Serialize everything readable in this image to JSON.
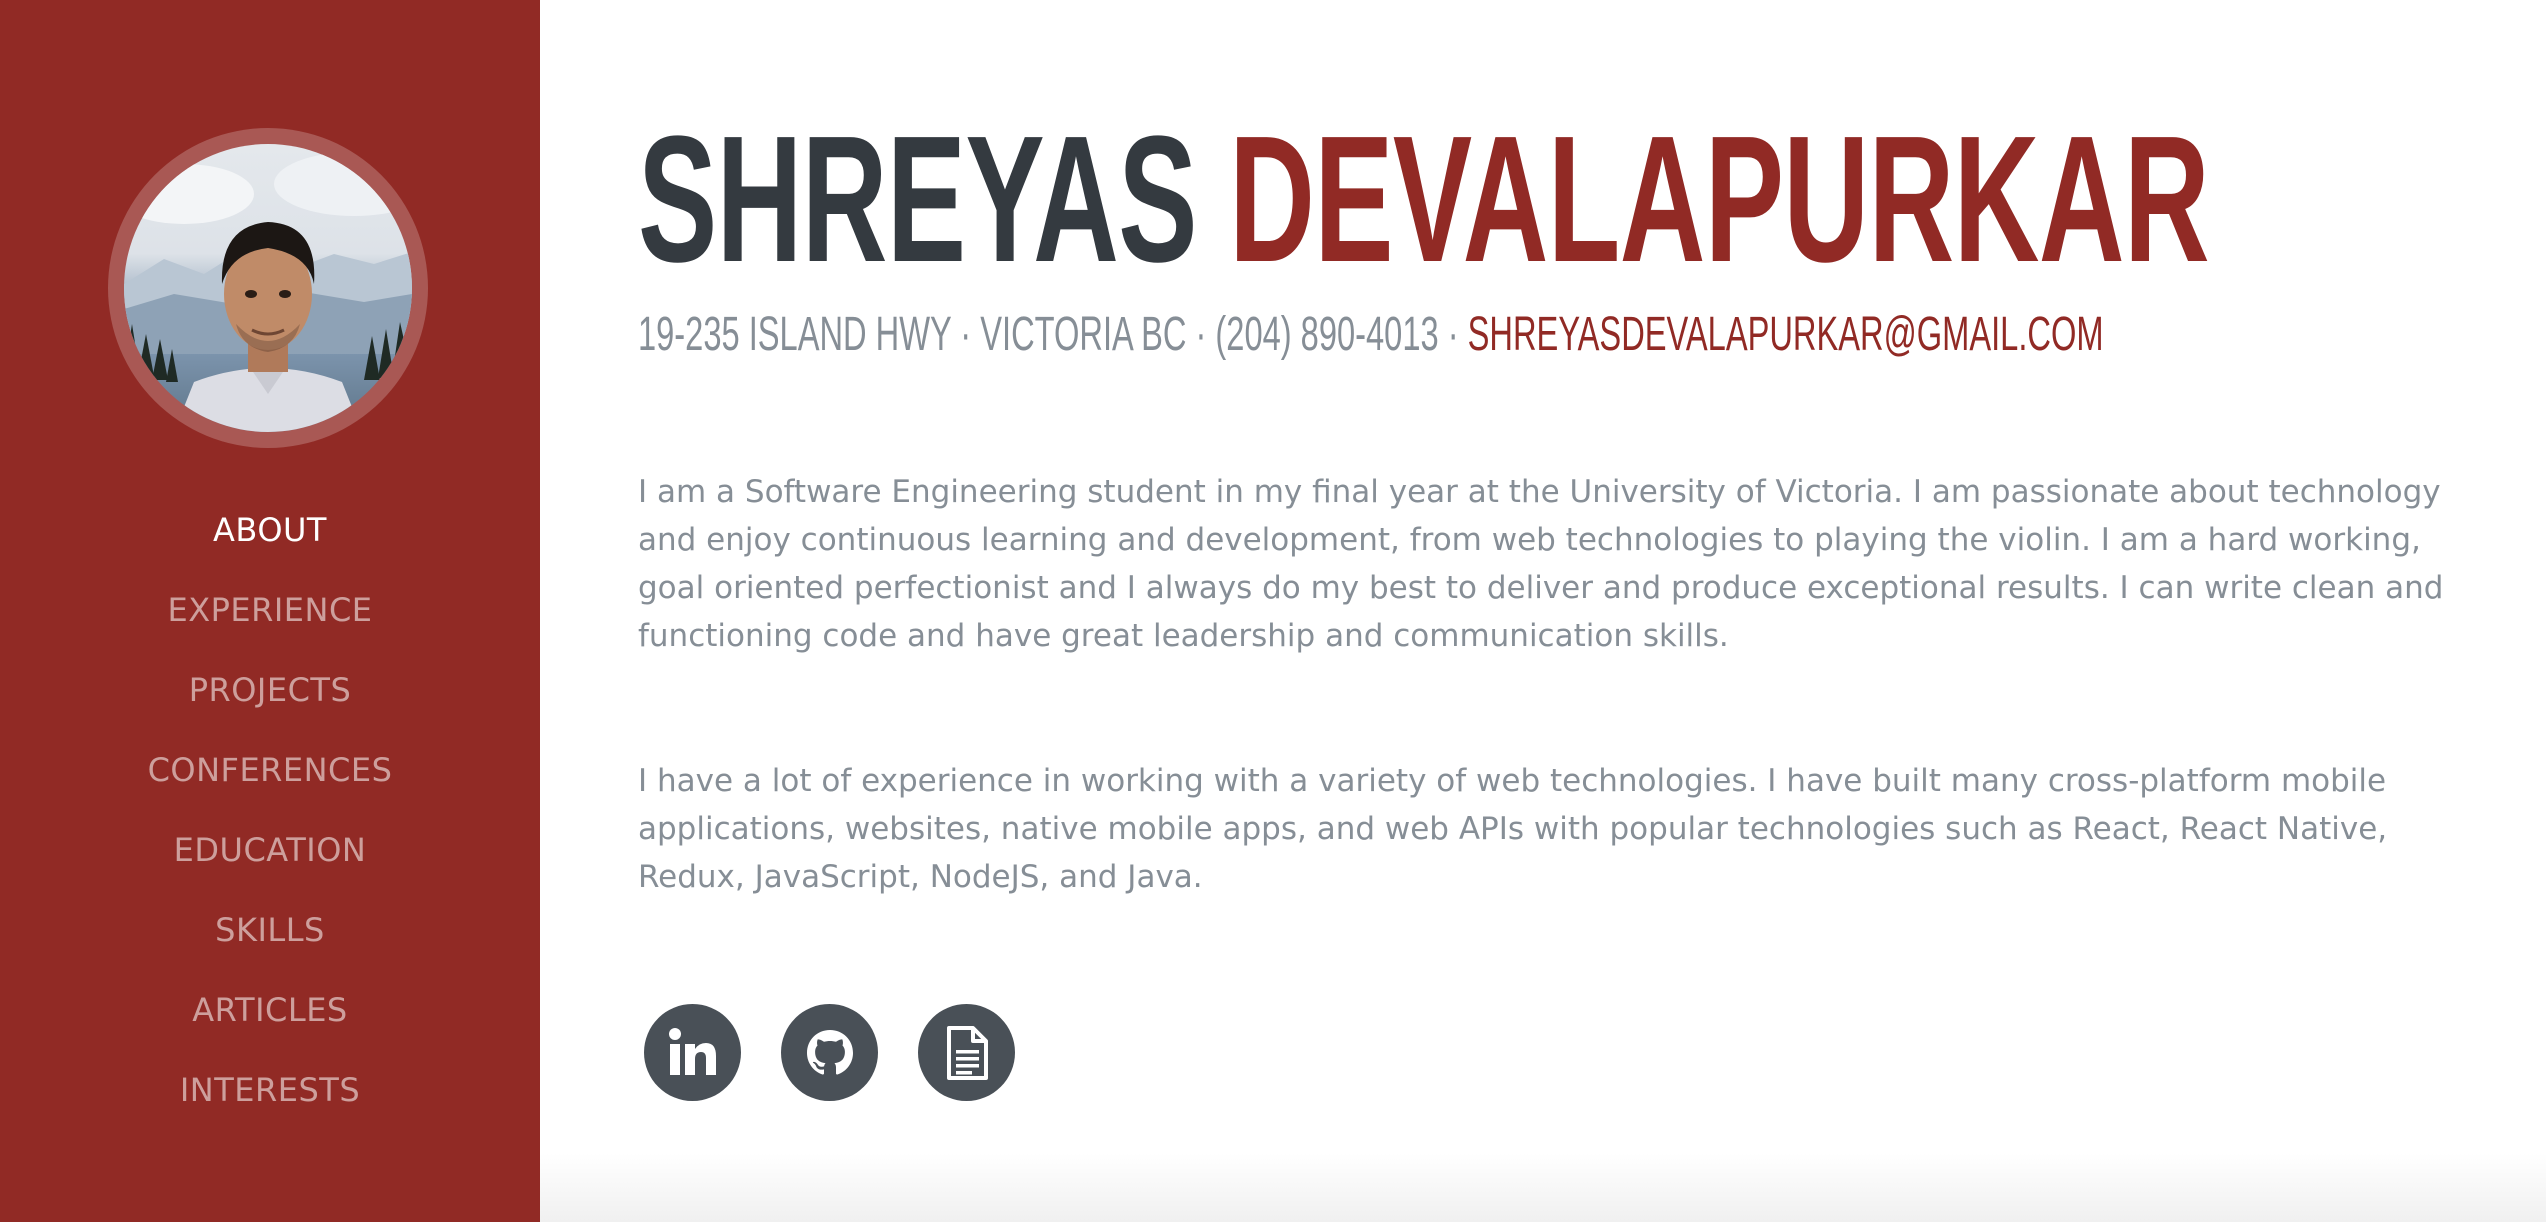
{
  "profile": {
    "first_name": "SHREYAS",
    "last_name": "DEVALAPURKAR",
    "address": "19-235 ISLAND HWY · VICTORIA BC · (204) 890-4013 ·",
    "email": "SHREYASDEVALAPURKAR@GMAIL.COM"
  },
  "nav": {
    "items": [
      {
        "label": "ABOUT",
        "active": true
      },
      {
        "label": "EXPERIENCE",
        "active": false
      },
      {
        "label": "PROJECTS",
        "active": false
      },
      {
        "label": "CONFERENCES",
        "active": false
      },
      {
        "label": "EDUCATION",
        "active": false
      },
      {
        "label": "SKILLS",
        "active": false
      },
      {
        "label": "ARTICLES",
        "active": false
      },
      {
        "label": "INTERESTS",
        "active": false
      }
    ]
  },
  "about": {
    "paragraph1": "I am a Software Engineering student in my final year at the University of Victoria. I am passionate about technology and enjoy continuous learning and development, from web technologies to playing the violin. I am a hard working, goal oriented perfectionist and I always do my best to deliver and produce exceptional results. I can write clean and functioning code and have great leadership and communication skills.",
    "paragraph2": "I have a lot of experience in working with a variety of web technologies. I have built many cross-platform mobile applications, websites, native mobile apps, and web APIs with popular technologies such as React, React Native, Redux, JavaScript, NodeJS, and Java."
  },
  "social": [
    {
      "icon": "linkedin-icon"
    },
    {
      "icon": "github-icon"
    },
    {
      "icon": "document-icon"
    }
  ],
  "colors": {
    "brand": "#912a25",
    "heading_dark": "#343a40",
    "muted_text": "#868e96",
    "social_bg": "#495057"
  }
}
